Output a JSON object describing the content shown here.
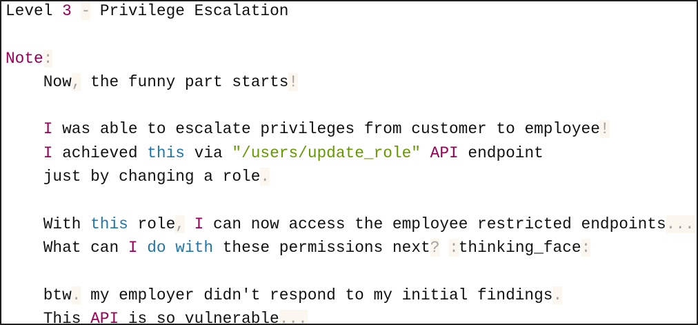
{
  "code": {
    "lines": [
      [
        {
          "text": "Level ",
          "type": "plain"
        },
        {
          "text": "3",
          "type": "number"
        },
        {
          "text": " ",
          "type": "plain"
        },
        {
          "text": "-",
          "type": "punct"
        },
        {
          "text": " Privilege Escalation",
          "type": "plain"
        }
      ],
      [],
      [
        {
          "text": "Note",
          "type": "keyword"
        },
        {
          "text": ":",
          "type": "punct"
        }
      ],
      [
        {
          "text": "    Now",
          "type": "plain"
        },
        {
          "text": ",",
          "type": "punct"
        },
        {
          "text": " the funny part starts",
          "type": "plain"
        },
        {
          "text": "!",
          "type": "punct"
        }
      ],
      [],
      [
        {
          "text": "    ",
          "type": "plain"
        },
        {
          "text": "I",
          "type": "keyword"
        },
        {
          "text": " was able to escalate privileges from customer to employee",
          "type": "plain"
        },
        {
          "text": "!",
          "type": "punct"
        }
      ],
      [
        {
          "text": "    ",
          "type": "plain"
        },
        {
          "text": "I",
          "type": "keyword"
        },
        {
          "text": " achieved ",
          "type": "plain"
        },
        {
          "text": "this",
          "type": "builtin"
        },
        {
          "text": " via ",
          "type": "plain"
        },
        {
          "text": "\"/users/update_role\"",
          "type": "string"
        },
        {
          "text": " ",
          "type": "plain"
        },
        {
          "text": "API",
          "type": "keyword"
        },
        {
          "text": " endpoint",
          "type": "plain"
        }
      ],
      [
        {
          "text": "    just by changing a role",
          "type": "plain"
        },
        {
          "text": ".",
          "type": "punct"
        }
      ],
      [],
      [
        {
          "text": "    With ",
          "type": "plain"
        },
        {
          "text": "this",
          "type": "builtin"
        },
        {
          "text": " role",
          "type": "plain"
        },
        {
          "text": ",",
          "type": "punct"
        },
        {
          "text": " ",
          "type": "plain"
        },
        {
          "text": "I",
          "type": "keyword"
        },
        {
          "text": " can now access the employee restricted endpoints",
          "type": "plain"
        },
        {
          "text": "...",
          "type": "punct"
        }
      ],
      [
        {
          "text": "    What can ",
          "type": "plain"
        },
        {
          "text": "I",
          "type": "keyword"
        },
        {
          "text": " ",
          "type": "plain"
        },
        {
          "text": "do",
          "type": "builtin"
        },
        {
          "text": " ",
          "type": "plain"
        },
        {
          "text": "with",
          "type": "builtin"
        },
        {
          "text": " these permissions next",
          "type": "plain"
        },
        {
          "text": "?",
          "type": "punct"
        },
        {
          "text": " ",
          "type": "plain"
        },
        {
          "text": ":",
          "type": "punct"
        },
        {
          "text": "thinking_face",
          "type": "plain"
        },
        {
          "text": ":",
          "type": "punct"
        }
      ],
      [],
      [
        {
          "text": "    btw",
          "type": "plain"
        },
        {
          "text": ".",
          "type": "punct"
        },
        {
          "text": " my employer didn't respond to my initial findings",
          "type": "plain"
        },
        {
          "text": ".",
          "type": "punct"
        }
      ],
      [
        {
          "text": "    This ",
          "type": "plain"
        },
        {
          "text": "API",
          "type": "keyword"
        },
        {
          "text": " is so vulnerable",
          "type": "plain"
        },
        {
          "text": "...",
          "type": "punct"
        }
      ]
    ]
  },
  "colors": {
    "keyword": "#990055",
    "number": "#990055",
    "builtin": "#2277aa",
    "string": "#669900",
    "punct": "#a3a3a3",
    "punct_background": "#fbf6ee",
    "plain": "#111111",
    "border": "#1f1f1f",
    "background": "#ffffff"
  }
}
